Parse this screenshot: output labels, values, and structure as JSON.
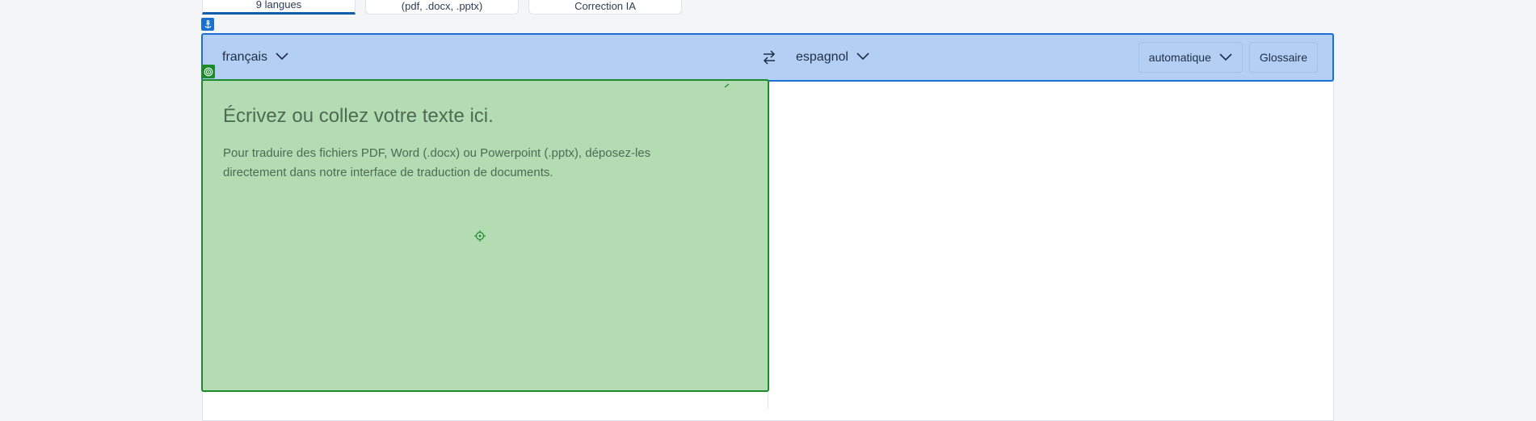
{
  "top_tabs": [
    {
      "label": "9 langues",
      "active": true
    },
    {
      "label": "(pdf, .docx, .pptx)",
      "active": false
    },
    {
      "label": "Correction IA",
      "active": false
    }
  ],
  "language_bar": {
    "source_language": "français",
    "target_language": "espagnol",
    "formality_select": "automatique",
    "glossary_button": "Glossaire"
  },
  "source_pane": {
    "placeholder_title": "Écrivez ou collez votre texte ici.",
    "placeholder_body": "Pour traduire des fichiers PDF, Word (.docx) ou Powerpoint (.pptx), déposez-les directement dans notre interface de traduction de documents."
  },
  "icons": {
    "swap": "swap-arrows-icon",
    "chevron": "chevron-down-icon",
    "anchor": "anchor-icon",
    "target": "target-icon",
    "crosshair": "crosshair-icon"
  },
  "colors": {
    "lang_bar_highlight": "#b3d0f4",
    "lang_bar_border": "#1a6fd3",
    "source_highlight": "#b3dcb3",
    "source_border": "#1a8a2a"
  }
}
